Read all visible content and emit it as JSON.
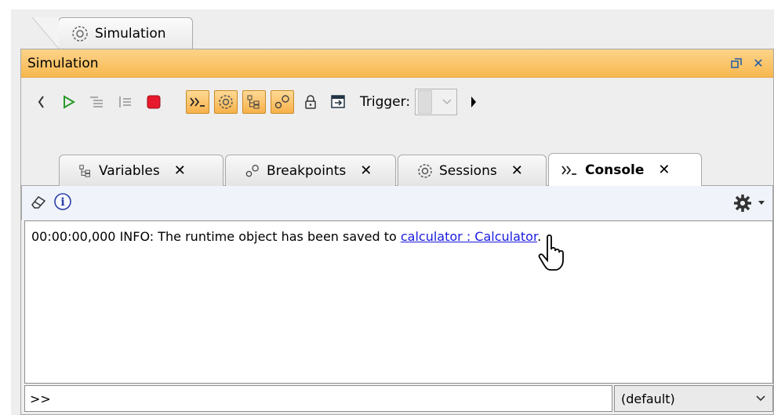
{
  "outer_tab": {
    "label": "Simulation",
    "icon": "gear-circle-icon"
  },
  "panel": {
    "title": "Simulation",
    "restore_icon": "restore-window-icon",
    "close_icon": "close-icon"
  },
  "toolbar": {
    "trigger_label": "Trigger:",
    "buttons": [
      "step-back-icon",
      "run-icon",
      "step-into-icon",
      "step-over-icon",
      "stop-icon",
      "console-icon",
      "sessions-icon",
      "variables-icon",
      "breakpoints-icon",
      "lock-icon",
      "export-icon"
    ]
  },
  "tabs": [
    {
      "label": "Variables",
      "icon": "variables-icon"
    },
    {
      "label": "Breakpoints",
      "icon": "breakpoints-icon"
    },
    {
      "label": "Sessions",
      "icon": "sessions-icon"
    },
    {
      "label": "Console",
      "icon": "console-prompt-icon",
      "active": true
    }
  ],
  "console": {
    "message_prefix": "00:00:00,000 INFO: The runtime object has been saved to ",
    "link_text": "calculator : Calculator",
    "message_suffix": ".",
    "prompt": ">>",
    "select_value": "(default)",
    "icons": [
      "eraser-icon",
      "info-icon",
      "settings-gear-icon"
    ]
  },
  "colors": {
    "accent_orange": "#f8b84f",
    "link_blue": "#1a1ae0"
  }
}
